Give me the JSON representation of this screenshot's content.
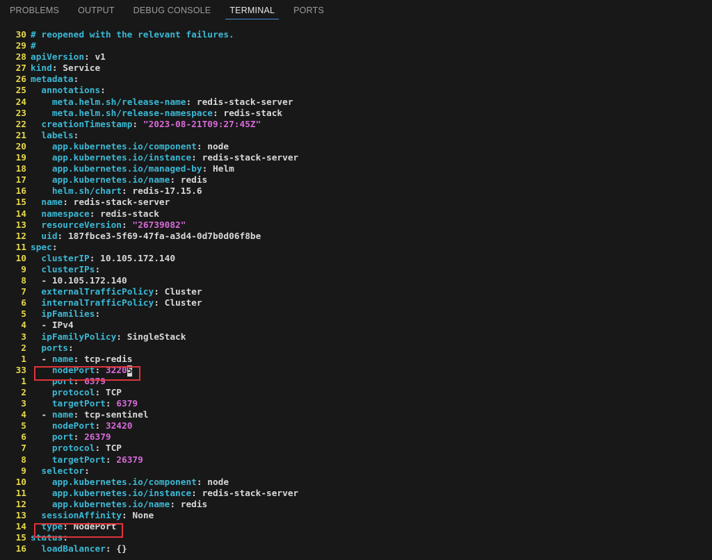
{
  "panel": {
    "tabs": [
      {
        "label": "PROBLEMS"
      },
      {
        "label": "OUTPUT"
      },
      {
        "label": "DEBUG CONSOLE"
      },
      {
        "label": "TERMINAL",
        "active": true
      },
      {
        "label": "PORTS"
      }
    ]
  },
  "colors": {
    "line_number": "#e7d84a",
    "key": "#3bb8d4",
    "string": "#d86ad8",
    "plain": "#d8d8d8",
    "highlight_box": "#e0353a"
  },
  "lines": [
    {
      "ln": "30",
      "indent": "",
      "parts": [
        {
          "t": "# reopened with the relevant failures.",
          "c": "c"
        }
      ]
    },
    {
      "ln": "29",
      "indent": "",
      "parts": [
        {
          "t": "#",
          "c": "c"
        }
      ]
    },
    {
      "ln": "28",
      "indent": "",
      "parts": [
        {
          "t": "apiVersion",
          "c": "k"
        },
        {
          "t": ": v1",
          "c": "p"
        }
      ]
    },
    {
      "ln": "27",
      "indent": "",
      "parts": [
        {
          "t": "kind",
          "c": "k"
        },
        {
          "t": ": Service",
          "c": "p"
        }
      ]
    },
    {
      "ln": "26",
      "indent": "",
      "parts": [
        {
          "t": "metadata",
          "c": "k"
        },
        {
          "t": ":",
          "c": "p"
        }
      ]
    },
    {
      "ln": "25",
      "indent": "  ",
      "parts": [
        {
          "t": "annotations",
          "c": "k"
        },
        {
          "t": ":",
          "c": "p"
        }
      ]
    },
    {
      "ln": "24",
      "indent": "    ",
      "parts": [
        {
          "t": "meta.helm.sh/release-name",
          "c": "k"
        },
        {
          "t": ": redis-stack-server",
          "c": "p"
        }
      ]
    },
    {
      "ln": "23",
      "indent": "    ",
      "parts": [
        {
          "t": "meta.helm.sh/release-namespace",
          "c": "k"
        },
        {
          "t": ": redis-stack",
          "c": "p"
        }
      ]
    },
    {
      "ln": "22",
      "indent": "  ",
      "parts": [
        {
          "t": "creationTimestamp",
          "c": "k"
        },
        {
          "t": ": ",
          "c": "p"
        },
        {
          "t": "\"2023-08-21T09:27:45Z\"",
          "c": "s"
        }
      ]
    },
    {
      "ln": "21",
      "indent": "  ",
      "parts": [
        {
          "t": "labels",
          "c": "k"
        },
        {
          "t": ":",
          "c": "p"
        }
      ]
    },
    {
      "ln": "20",
      "indent": "    ",
      "parts": [
        {
          "t": "app.kubernetes.io/component",
          "c": "k"
        },
        {
          "t": ": node",
          "c": "p"
        }
      ]
    },
    {
      "ln": "19",
      "indent": "    ",
      "parts": [
        {
          "t": "app.kubernetes.io/instance",
          "c": "k"
        },
        {
          "t": ": redis-stack-server",
          "c": "p"
        }
      ]
    },
    {
      "ln": "18",
      "indent": "    ",
      "parts": [
        {
          "t": "app.kubernetes.io/managed-by",
          "c": "k"
        },
        {
          "t": ": Helm",
          "c": "p"
        }
      ]
    },
    {
      "ln": "17",
      "indent": "    ",
      "parts": [
        {
          "t": "app.kubernetes.io/name",
          "c": "k"
        },
        {
          "t": ": redis",
          "c": "p"
        }
      ]
    },
    {
      "ln": "16",
      "indent": "    ",
      "parts": [
        {
          "t": "helm.sh/chart",
          "c": "k"
        },
        {
          "t": ": redis-17.15.6",
          "c": "p"
        }
      ]
    },
    {
      "ln": "15",
      "indent": "  ",
      "parts": [
        {
          "t": "name",
          "c": "k"
        },
        {
          "t": ": redis-stack-server",
          "c": "p"
        }
      ]
    },
    {
      "ln": "14",
      "indent": "  ",
      "parts": [
        {
          "t": "namespace",
          "c": "k"
        },
        {
          "t": ": redis-stack",
          "c": "p"
        }
      ]
    },
    {
      "ln": "13",
      "indent": "  ",
      "parts": [
        {
          "t": "resourceVersion",
          "c": "k"
        },
        {
          "t": ": ",
          "c": "p"
        },
        {
          "t": "\"26739082\"",
          "c": "s"
        }
      ]
    },
    {
      "ln": "12",
      "indent": "  ",
      "parts": [
        {
          "t": "uid",
          "c": "k"
        },
        {
          "t": ": 187fbce3-5f69-47fa-a3d4-0d7b0d06f8be",
          "c": "p"
        }
      ]
    },
    {
      "ln": "11",
      "indent": "",
      "parts": [
        {
          "t": "spec",
          "c": "k"
        },
        {
          "t": ":",
          "c": "p"
        }
      ]
    },
    {
      "ln": "10",
      "indent": "  ",
      "parts": [
        {
          "t": "clusterIP",
          "c": "k"
        },
        {
          "t": ": 10.105.172.140",
          "c": "p"
        }
      ]
    },
    {
      "ln": "9",
      "indent": "  ",
      "parts": [
        {
          "t": "clusterIPs",
          "c": "k"
        },
        {
          "t": ":",
          "c": "p"
        }
      ]
    },
    {
      "ln": "8",
      "indent": "  ",
      "parts": [
        {
          "t": "- 10.105.172.140",
          "c": "p"
        }
      ]
    },
    {
      "ln": "7",
      "indent": "  ",
      "parts": [
        {
          "t": "externalTrafficPolicy",
          "c": "k"
        },
        {
          "t": ": Cluster",
          "c": "p"
        }
      ]
    },
    {
      "ln": "6",
      "indent": "  ",
      "parts": [
        {
          "t": "internalTrafficPolicy",
          "c": "k"
        },
        {
          "t": ": Cluster",
          "c": "p"
        }
      ]
    },
    {
      "ln": "5",
      "indent": "  ",
      "parts": [
        {
          "t": "ipFamilies",
          "c": "k"
        },
        {
          "t": ":",
          "c": "p"
        }
      ]
    },
    {
      "ln": "4",
      "indent": "  ",
      "parts": [
        {
          "t": "- IPv4",
          "c": "p"
        }
      ]
    },
    {
      "ln": "3",
      "indent": "  ",
      "parts": [
        {
          "t": "ipFamilyPolicy",
          "c": "k"
        },
        {
          "t": ": SingleStack",
          "c": "p"
        }
      ]
    },
    {
      "ln": "2",
      "indent": "  ",
      "parts": [
        {
          "t": "ports",
          "c": "k"
        },
        {
          "t": ":",
          "c": "p"
        }
      ]
    },
    {
      "ln": "1",
      "indent": "  ",
      "parts": [
        {
          "t": "- ",
          "c": "p"
        },
        {
          "t": "name",
          "c": "k"
        },
        {
          "t": ": tcp-redis",
          "c": "p"
        }
      ]
    },
    {
      "ln": "33",
      "indent": "    ",
      "current": true,
      "parts": [
        {
          "t": "nodePort",
          "c": "k"
        },
        {
          "t": ": ",
          "c": "p"
        },
        {
          "t": "3220",
          "c": "n"
        },
        {
          "t": "5",
          "c": "cursor"
        }
      ]
    },
    {
      "ln": "1",
      "indent": "    ",
      "parts": [
        {
          "t": "port",
          "c": "k"
        },
        {
          "t": ": ",
          "c": "p"
        },
        {
          "t": "6379",
          "c": "n"
        }
      ]
    },
    {
      "ln": "2",
      "indent": "    ",
      "parts": [
        {
          "t": "protocol",
          "c": "k"
        },
        {
          "t": ": TCP",
          "c": "p"
        }
      ]
    },
    {
      "ln": "3",
      "indent": "    ",
      "parts": [
        {
          "t": "targetPort",
          "c": "k"
        },
        {
          "t": ": ",
          "c": "p"
        },
        {
          "t": "6379",
          "c": "n"
        }
      ]
    },
    {
      "ln": "4",
      "indent": "  ",
      "parts": [
        {
          "t": "- ",
          "c": "p"
        },
        {
          "t": "name",
          "c": "k"
        },
        {
          "t": ": tcp-sentinel",
          "c": "p"
        }
      ]
    },
    {
      "ln": "5",
      "indent": "    ",
      "parts": [
        {
          "t": "nodePort",
          "c": "k"
        },
        {
          "t": ": ",
          "c": "p"
        },
        {
          "t": "32420",
          "c": "n"
        }
      ]
    },
    {
      "ln": "6",
      "indent": "    ",
      "parts": [
        {
          "t": "port",
          "c": "k"
        },
        {
          "t": ": ",
          "c": "p"
        },
        {
          "t": "26379",
          "c": "n"
        }
      ]
    },
    {
      "ln": "7",
      "indent": "    ",
      "parts": [
        {
          "t": "protocol",
          "c": "k"
        },
        {
          "t": ": TCP",
          "c": "p"
        }
      ]
    },
    {
      "ln": "8",
      "indent": "    ",
      "parts": [
        {
          "t": "targetPort",
          "c": "k"
        },
        {
          "t": ": ",
          "c": "p"
        },
        {
          "t": "26379",
          "c": "n"
        }
      ]
    },
    {
      "ln": "9",
      "indent": "  ",
      "parts": [
        {
          "t": "selector",
          "c": "k"
        },
        {
          "t": ":",
          "c": "p"
        }
      ]
    },
    {
      "ln": "10",
      "indent": "    ",
      "parts": [
        {
          "t": "app.kubernetes.io/component",
          "c": "k"
        },
        {
          "t": ": node",
          "c": "p"
        }
      ]
    },
    {
      "ln": "11",
      "indent": "    ",
      "parts": [
        {
          "t": "app.kubernetes.io/instance",
          "c": "k"
        },
        {
          "t": ": redis-stack-server",
          "c": "p"
        }
      ]
    },
    {
      "ln": "12",
      "indent": "    ",
      "parts": [
        {
          "t": "app.kubernetes.io/name",
          "c": "k"
        },
        {
          "t": ": redis",
          "c": "p"
        }
      ]
    },
    {
      "ln": "13",
      "indent": "  ",
      "parts": [
        {
          "t": "sessionAffinity",
          "c": "k"
        },
        {
          "t": ": None",
          "c": "p"
        }
      ]
    },
    {
      "ln": "14",
      "indent": "  ",
      "parts": [
        {
          "t": "type",
          "c": "k"
        },
        {
          "t": ": NodePort",
          "c": "p"
        }
      ]
    },
    {
      "ln": "15",
      "indent": "",
      "parts": [
        {
          "t": "status",
          "c": "k"
        },
        {
          "t": ":",
          "c": "p"
        }
      ]
    },
    {
      "ln": "16",
      "indent": "  ",
      "parts": [
        {
          "t": "loadBalancer",
          "c": "k"
        },
        {
          "t": ": {}",
          "c": "p"
        }
      ]
    }
  ]
}
